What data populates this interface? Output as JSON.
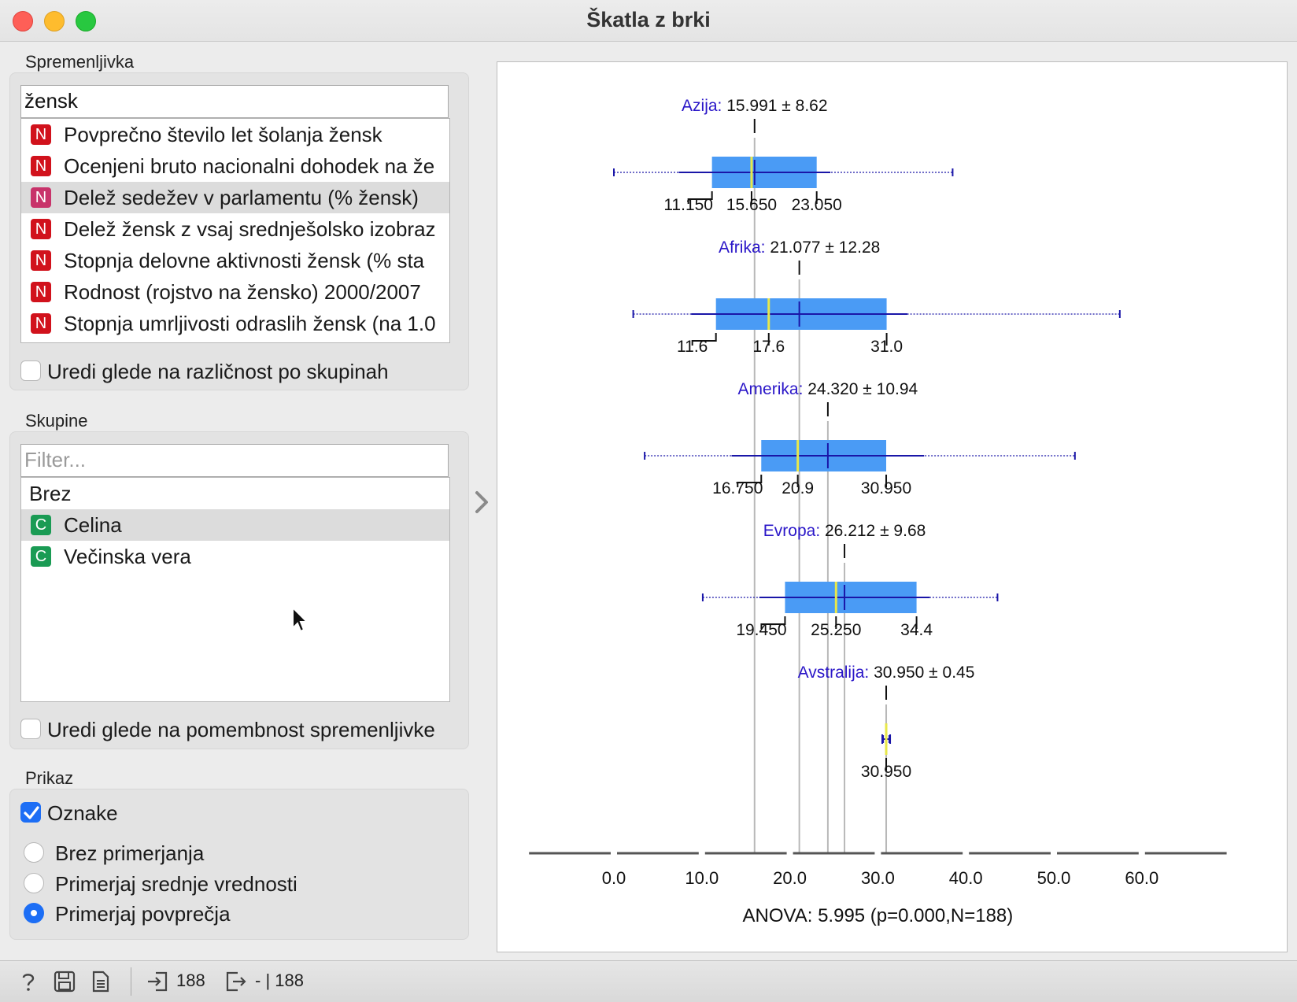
{
  "window": {
    "title": "Škatla z brki"
  },
  "variable_section": {
    "label": "Spremenljivka",
    "search_value": "žensk",
    "items": [
      {
        "badge": "N",
        "label": "Povprečno število let šolanja žensk"
      },
      {
        "badge": "N",
        "label": "Ocenjeni bruto nacionalni dohodek na že"
      },
      {
        "badge": "N",
        "label": "Delež sedežev v parlamentu (% žensk)",
        "selected": true
      },
      {
        "badge": "N",
        "label": "Delež žensk z vsaj srednješolsko izobraz"
      },
      {
        "badge": "N",
        "label": "Stopnja delovne aktivnosti žensk (% sta"
      },
      {
        "badge": "N",
        "label": "Rodnost (rojstvo na žensko) 2000/2007"
      },
      {
        "badge": "N",
        "label": "Stopnja umrljivosti odraslih žensk (na 1.0"
      }
    ],
    "order_checkbox": {
      "label": "Uredi glede na različnost po skupinah",
      "checked": false
    }
  },
  "groups_section": {
    "label": "Skupine",
    "filter_placeholder": "Filter...",
    "items": [
      {
        "badge": "",
        "label": "Brez"
      },
      {
        "badge": "C",
        "label": "Celina",
        "selected": true
      },
      {
        "badge": "C",
        "label": "Večinska vera"
      }
    ],
    "order_checkbox": {
      "label": "Uredi glede na pomembnost spremenljivke",
      "checked": false
    }
  },
  "display_section": {
    "label": "Prikaz",
    "labels_checkbox": {
      "label": "Oznake",
      "checked": true
    },
    "radios": [
      {
        "label": "Brez primerjanja",
        "selected": false
      },
      {
        "label": "Primerjaj srednje vrednosti",
        "selected": false
      },
      {
        "label": "Primerjaj povprečja",
        "selected": true
      }
    ]
  },
  "status_bar": {
    "input_count": "188",
    "output_count": "- | 188"
  },
  "colors": {
    "box": "#4a9bf5",
    "median": "#e8e84a",
    "mean": "#1a16a8",
    "group_label": "#2a16c8"
  },
  "chart_data": {
    "type": "box",
    "x_ticks": [
      "0.0",
      "10.0",
      "20.0",
      "30.0",
      "40.0",
      "50.0",
      "60.0"
    ],
    "xlim": [
      -10,
      70
    ],
    "footer": "ANOVA: 5.995 (p=0.000,N=188)",
    "groups": [
      {
        "name": "Azija:",
        "stat": "15.991 ± 8.62",
        "mean": 15.991,
        "sd": 8.62,
        "min": 0.0,
        "q1": 11.15,
        "median": 15.65,
        "q3": 23.05,
        "max": 38.5,
        "q1_label": "11.150",
        "median_label": "15.650",
        "q3_label": "23.050"
      },
      {
        "name": "Afrika:",
        "stat": "21.077 ± 12.28",
        "mean": 21.077,
        "sd": 12.28,
        "min": 2.2,
        "q1": 11.6,
        "median": 17.6,
        "q3": 31.0,
        "max": 57.5,
        "q1_label": "11.6",
        "median_label": "17.6",
        "q3_label": "31.0"
      },
      {
        "name": "Amerika:",
        "stat": "24.320 ± 10.94",
        "mean": 24.32,
        "sd": 10.94,
        "min": 3.5,
        "q1": 16.75,
        "median": 20.9,
        "q3": 30.95,
        "max": 52.4,
        "q1_label": "16.750",
        "median_label": "20.9",
        "q3_label": "30.950"
      },
      {
        "name": "Evropa:",
        "stat": "26.212 ± 9.68",
        "mean": 26.212,
        "sd": 9.68,
        "min": 10.1,
        "q1": 19.45,
        "median": 25.25,
        "q3": 34.4,
        "max": 43.6,
        "q1_label": "19.450",
        "median_label": "25.250",
        "q3_label": "34.4"
      },
      {
        "name": "Avstralija:",
        "stat": "30.950 ± 0.45",
        "mean": 30.95,
        "sd": 0.45,
        "min": 30.6,
        "q1": 30.95,
        "median": 30.95,
        "q3": 30.95,
        "max": 31.3,
        "q1_label": "",
        "median_label": "30.950",
        "q3_label": ""
      }
    ]
  }
}
